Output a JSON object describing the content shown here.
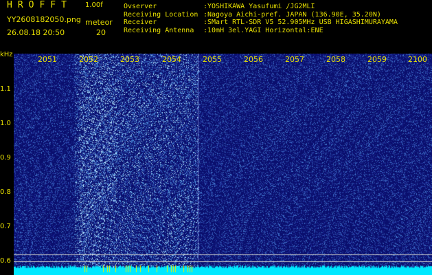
{
  "header": {
    "logo": "HROFFT",
    "version": "1.00f",
    "filename": "YY2608182050.png",
    "datetime": "26.08.18 20:50",
    "meteor_label": "meteor",
    "meteor_count": "20"
  },
  "info": [
    {
      "key": "Ovserver",
      "value": ":YOSHIKAWA Yasufumi /JG2MLI"
    },
    {
      "key": "Receiving Location",
      "value": ":Nagoya Aichi-pref. JAPAN (136.90E, 35.20N)"
    },
    {
      "key": "Receiver",
      "value": ":SMart RTL-SDR V5 52.905MHz USB HIGASHIMURAYAMA"
    },
    {
      "key": "Receiving Antenna",
      "value": ":10mH 3el.YAGI Horizontal:ENE"
    }
  ],
  "axis": {
    "y_unit": "kHz",
    "y_ticks": [
      "1.1",
      "1.0",
      "0.9",
      "0.8",
      "0.7",
      "0.6"
    ],
    "x_ticks": [
      "2051",
      "2052",
      "2053",
      "2054",
      "2055",
      "2056",
      "2057",
      "2058",
      "2059",
      "2100"
    ]
  },
  "colors": {
    "text": "#e8e000",
    "background": "#0a0f7a",
    "signal": "#00e8ff"
  }
}
